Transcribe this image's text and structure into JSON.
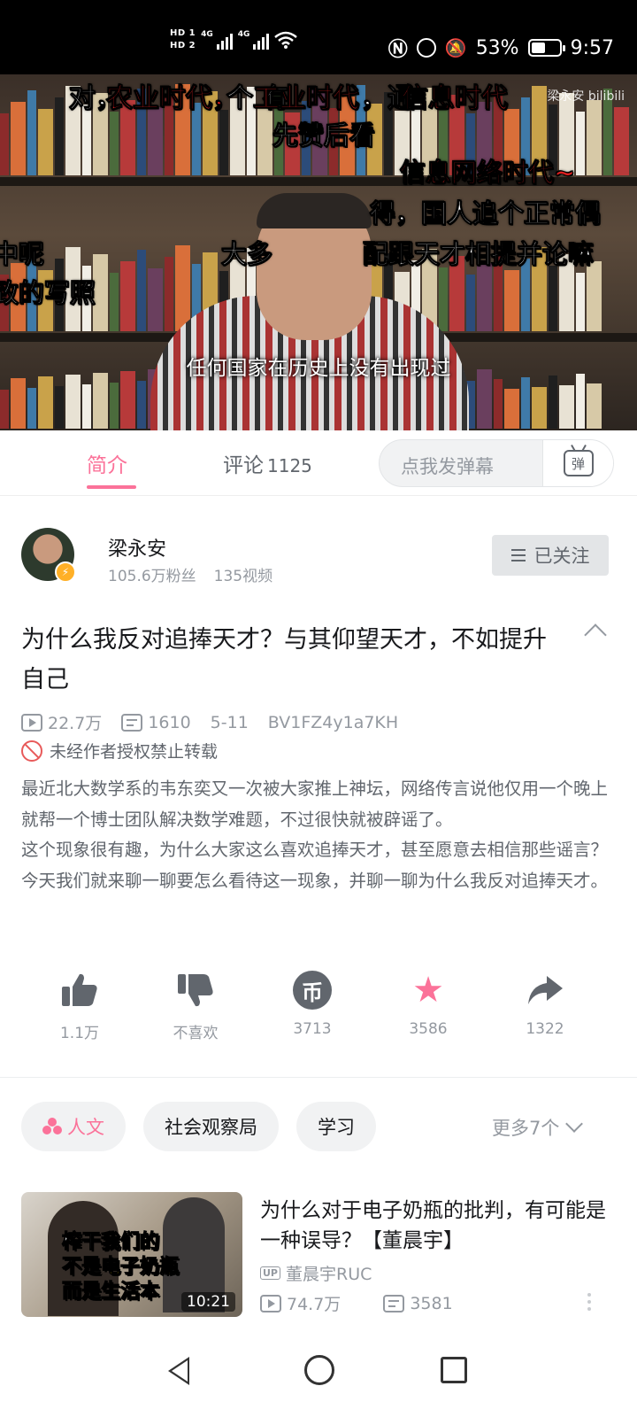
{
  "status_bar": {
    "hd1": "HD 1",
    "hd2": "HD 2",
    "net1": "4G",
    "net2": "4G",
    "battery_percent": "53%",
    "battery_level": 0.53,
    "time": "9:57",
    "icons": [
      "nfc-icon",
      "alarm-icon",
      "mute-icon",
      "wifi-icon",
      "battery-icon"
    ]
  },
  "video": {
    "watermark": "梁永安 bilibili",
    "subtitle": "任何国家在历史上没有出现过",
    "danmaku": [
      {
        "text": "对，",
        "red": false
      },
      {
        "text": "农业时代，",
        "red": true
      },
      {
        "text": "个 有 ",
        "red": false
      },
      {
        "text": "工业时代",
        "red": true
      },
      {
        "text": "，通 ",
        "red": false
      },
      {
        "text": "信息时代",
        "red": true
      },
      {
        "text": "先赞后看",
        "red": false
      },
      {
        "text": "信息网络时代~",
        "red": true
      },
      {
        "text": "得，国人追个正常偶",
        "red": false
      },
      {
        "text": "中呢",
        "red": false
      },
      {
        "text": "大多",
        "red": false
      },
      {
        "text": "配跟天才相提并论嘛",
        "red": false
      },
      {
        "text": "致的写照",
        "red": false
      }
    ]
  },
  "tabs": {
    "intro": "简介",
    "comments": "评论",
    "comment_count": "1125",
    "danmaku_placeholder": "点我发弹幕",
    "danmaku_button": "弹"
  },
  "uploader": {
    "name": "梁永安",
    "fans": "105.6万粉丝",
    "videos": "135视频",
    "follow_label": "已关注"
  },
  "video_info": {
    "title": "为什么我反对追捧天才？与其仰望天才，不如提升自己",
    "views": "22.7万",
    "danmaku_count": "1610",
    "date": "5-11",
    "bvid": "BV1FZ4y1a7KH",
    "copyright": "未经作者授权禁止转载",
    "description_1": "最近北大数学系的韦东奕又一次被大家推上神坛，网络传言说他仅用一个晚上就帮一个博士团队解决数学难题，不过很快就被辟谣了。",
    "description_2": "这个现象很有趣，为什么大家这么喜欢追捧天才，甚至愿意去相信那些谣言？今天我们就来聊一聊要怎么看待这一现象，并聊一聊为什么我反对追捧天才。"
  },
  "actions": {
    "like": "1.1万",
    "dislike": "不喜欢",
    "coin": "3713",
    "coin_glyph": "币",
    "favorite": "3586",
    "share": "1322"
  },
  "tags": {
    "items": [
      "人文",
      "社会观察局",
      "学习"
    ],
    "more": "更多7个"
  },
  "recommended": {
    "thumb_line_1_white": "榨干我们的",
    "thumb_line_2_white": "不是",
    "thumb_line_2_yellow": "电子奶瓶",
    "thumb_line_3_white": "而是",
    "thumb_line_3_yellow": "生活本",
    "duration": "10:21",
    "title": "为什么对于电子奶瓶的批判，有可能是一种误导？【董晨宇】",
    "up_badge": "UP",
    "up_name": "董晨宇RUC",
    "views": "74.7万",
    "danmaku": "3581"
  },
  "colors": {
    "accent": "#fb7299",
    "text_primary": "#18191c",
    "text_secondary": "#61666d",
    "text_muted": "#9499a0",
    "danmaku_red": "#e02020"
  }
}
